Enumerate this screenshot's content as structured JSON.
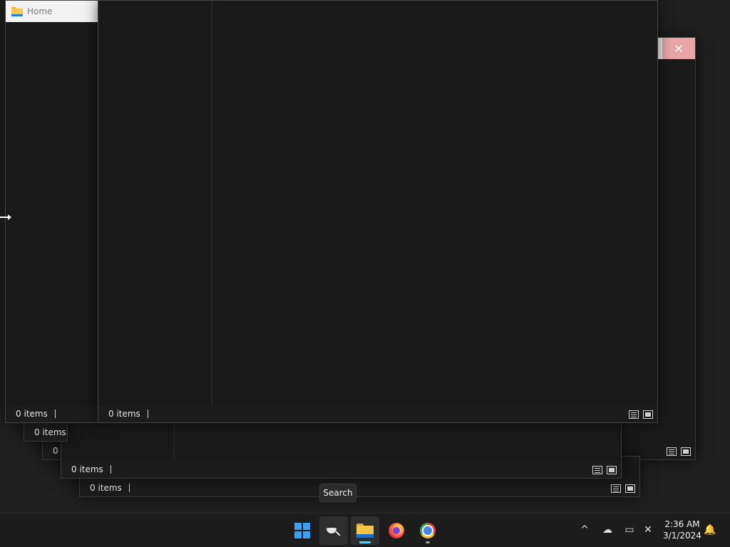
{
  "windows": {
    "front": {
      "status_items": "0 items"
    },
    "left": {
      "title": "Home",
      "status_items": "0 items"
    },
    "back_a": {
      "status_items": "0 items"
    },
    "back_b": {
      "status_items": "0 items"
    },
    "back_c": {
      "status_items": "0 items"
    },
    "back_d": {
      "status_items": "0 items"
    },
    "back_e": {
      "status_items": "0 i"
    }
  },
  "close_glyph": "✕",
  "tooltip": {
    "text": "Search"
  },
  "taskbar": {
    "start_icon": "windows-logo-icon",
    "apps": [
      {
        "name": "search-icon"
      },
      {
        "name": "file-explorer-icon",
        "active": true
      },
      {
        "name": "firefox-icon"
      },
      {
        "name": "chrome-icon"
      }
    ],
    "tray": {
      "chevron": "^",
      "onedrive": "☁",
      "network": "▭",
      "volume": "✕",
      "notification": "🔔"
    },
    "clock": {
      "time": "2:36 AM",
      "date": "3/1/2024"
    }
  },
  "colors": {
    "accent": "#3aa0f3",
    "close_hover": "#e8a5a8",
    "window_bg": "#191919",
    "taskbar_bg": "#1c1c1c"
  }
}
